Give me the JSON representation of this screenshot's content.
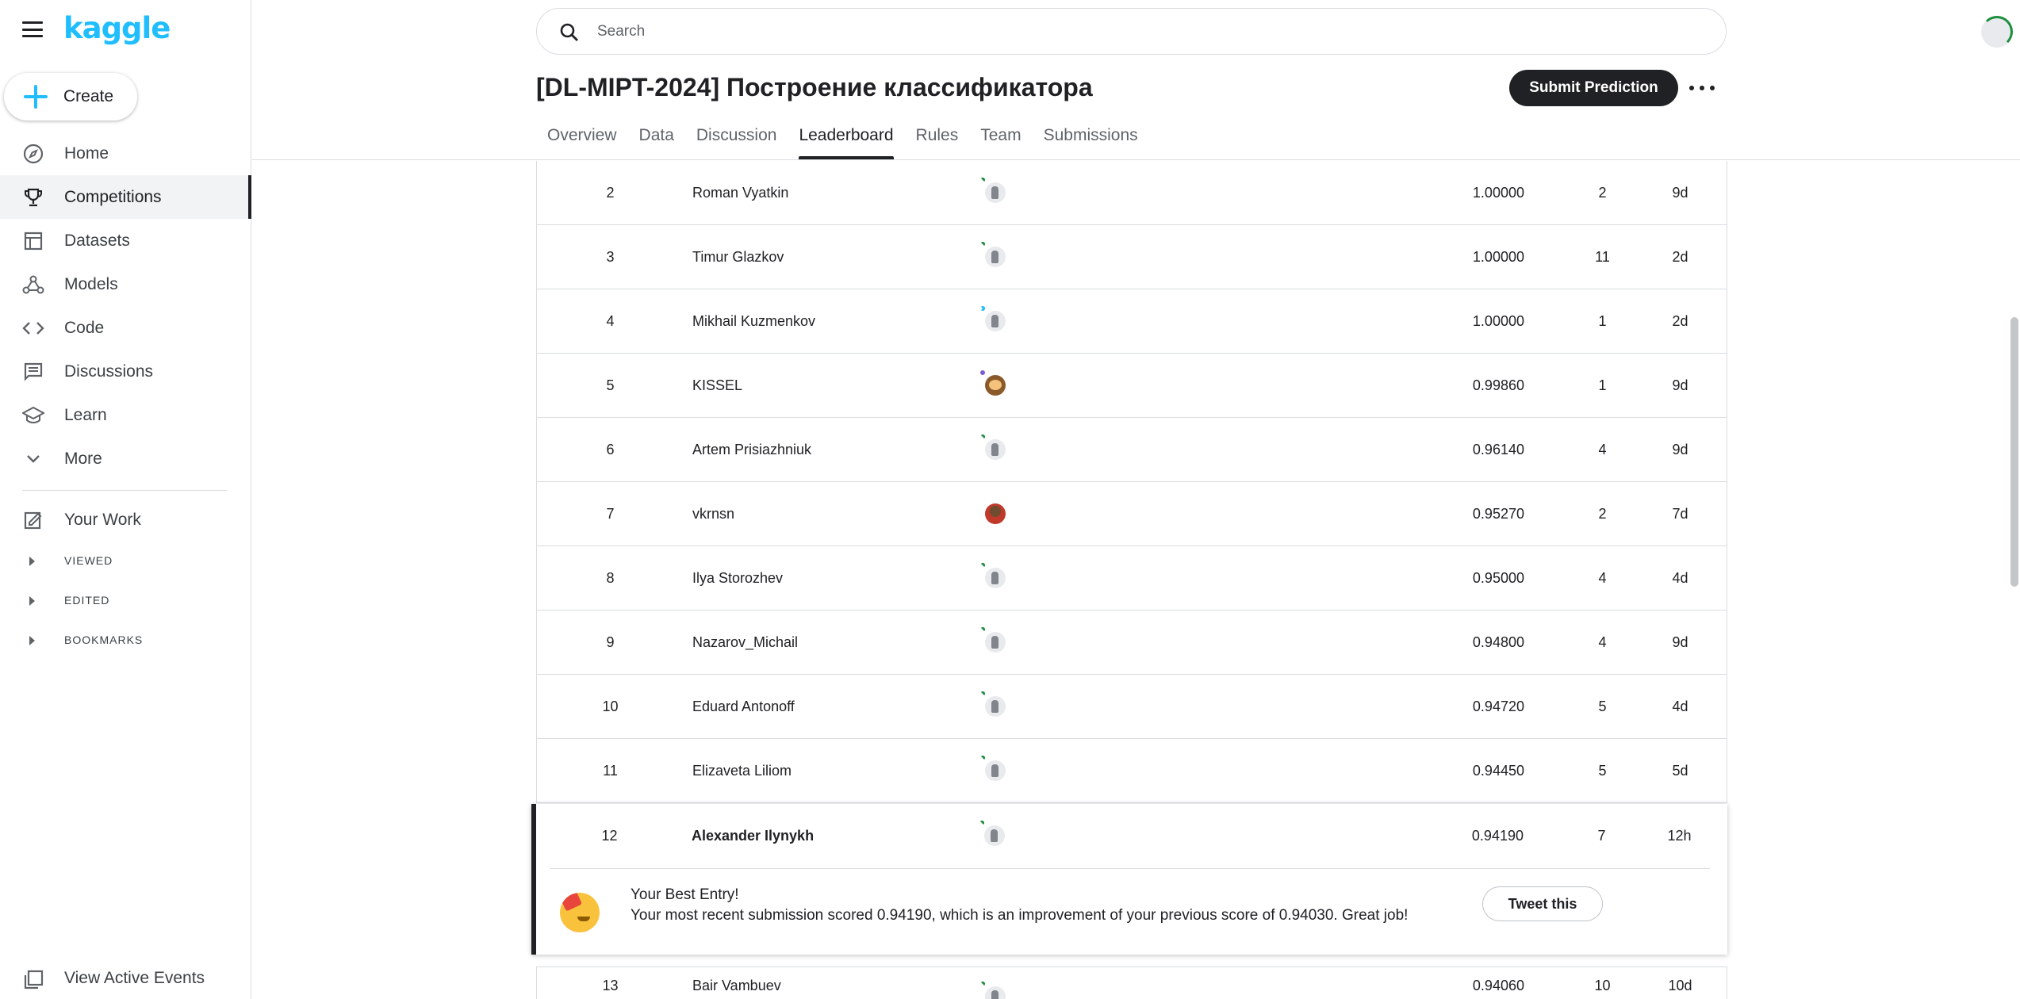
{
  "app": {
    "logo": "kaggle",
    "create_label": "Create"
  },
  "sidebar": {
    "items": [
      {
        "label": "Home",
        "icon": "compass-icon"
      },
      {
        "label": "Competitions",
        "icon": "trophy-icon",
        "active": true
      },
      {
        "label": "Datasets",
        "icon": "table-icon"
      },
      {
        "label": "Models",
        "icon": "models-icon"
      },
      {
        "label": "Code",
        "icon": "code-icon"
      },
      {
        "label": "Discussions",
        "icon": "comments-icon"
      },
      {
        "label": "Learn",
        "icon": "school-icon"
      },
      {
        "label": "More",
        "icon": "chevron-down-icon"
      }
    ],
    "your_work": "Your Work",
    "sections": [
      "VIEWED",
      "EDITED",
      "BOOKMARKS"
    ],
    "active_events": "View Active Events"
  },
  "search": {
    "placeholder": "Search"
  },
  "competition": {
    "title": "[DL-MIPT-2024] Построение классификатора",
    "submit_label": "Submit Prediction",
    "tabs": [
      "Overview",
      "Data",
      "Discussion",
      "Leaderboard",
      "Rules",
      "Team",
      "Submissions"
    ],
    "active_tab": "Leaderboard"
  },
  "leaderboard": {
    "rows": [
      {
        "rank": "2",
        "name": "Roman Vyatkin",
        "avatar": "green",
        "score": "1.00000",
        "entries": "2",
        "last": "9d"
      },
      {
        "rank": "3",
        "name": "Timur Glazkov",
        "avatar": "green",
        "score": "1.00000",
        "entries": "11",
        "last": "2d"
      },
      {
        "rank": "4",
        "name": "Mikhail Kuzmenkov",
        "avatar": "blue",
        "score": "1.00000",
        "entries": "1",
        "last": "2d"
      },
      {
        "rank": "5",
        "name": "KISSEL",
        "avatar": "purple",
        "score": "0.99860",
        "entries": "1",
        "last": "9d"
      },
      {
        "rank": "6",
        "name": "Artem Prisiazhniuk",
        "avatar": "green",
        "score": "0.96140",
        "entries": "4",
        "last": "9d"
      },
      {
        "rank": "7",
        "name": "vkrnsn",
        "avatar": "photo",
        "score": "0.95270",
        "entries": "2",
        "last": "7d"
      },
      {
        "rank": "8",
        "name": "Ilya Storozhev",
        "avatar": "green",
        "score": "0.95000",
        "entries": "4",
        "last": "4d"
      },
      {
        "rank": "9",
        "name": "Nazarov_Michail",
        "avatar": "green",
        "score": "0.94800",
        "entries": "4",
        "last": "9d"
      },
      {
        "rank": "10",
        "name": "Eduard Antonoff",
        "avatar": "green",
        "score": "0.94720",
        "entries": "5",
        "last": "4d"
      },
      {
        "rank": "11",
        "name": "Elizaveta Liliom",
        "avatar": "green",
        "score": "0.94450",
        "entries": "5",
        "last": "5d"
      }
    ],
    "my_row": {
      "rank": "12",
      "name": "Alexander Ilynykh",
      "avatar": "green",
      "score": "0.94190",
      "entries": "7",
      "last": "12h"
    },
    "best_entry_title": "Your Best Entry!",
    "best_entry_message": "Your most recent submission scored 0.94190, which is an improvement of your previous score of 0.94030. Great job!",
    "tweet_label": "Tweet this",
    "partial_row": {
      "rank": "13",
      "name": "Bair Vambuev",
      "avatar": "green",
      "score": "0.94060",
      "entries": "10",
      "last": "10d"
    }
  }
}
